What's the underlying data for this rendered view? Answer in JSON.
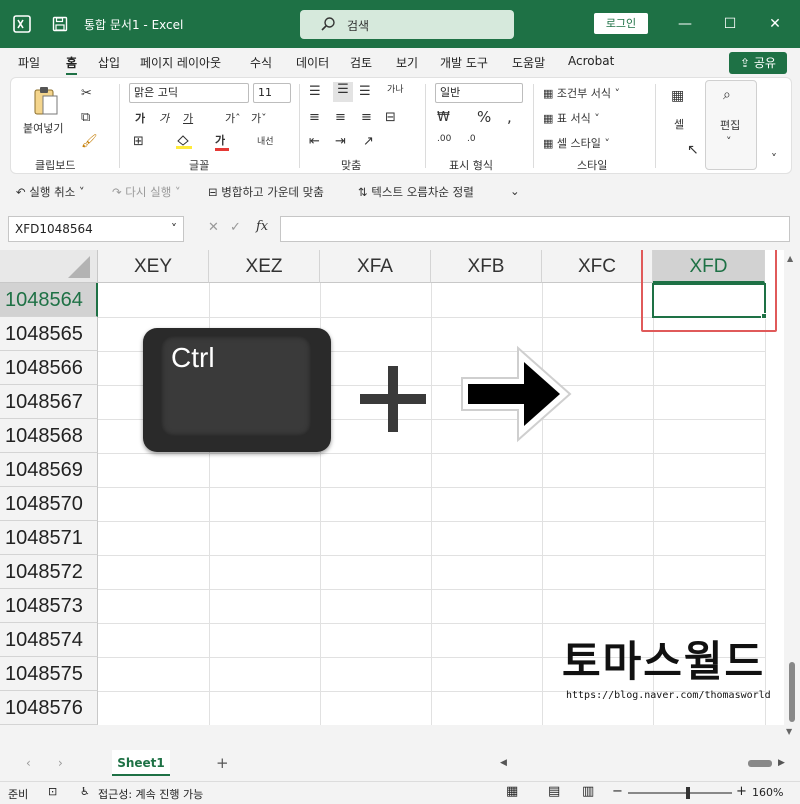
{
  "app": {
    "doc_title": "통합 문서1  -  Excel",
    "search_placeholder": "검색",
    "login_label": "로그인",
    "share_label": "공유"
  },
  "menu": {
    "tabs": [
      "파일",
      "홈",
      "삽입",
      "페이지 레이아웃",
      "수식",
      "데이터",
      "검토",
      "보기",
      "개발 도구",
      "도움말",
      "Acrobat"
    ],
    "active": "홈"
  },
  "ribbon": {
    "paste_label": "붙여넣기",
    "clipboard_label": "클립보드",
    "font_name": "맑은 고딕",
    "font_size": "11",
    "font_group_label": "글꼴",
    "align_group_label": "맞춤",
    "number_format": "일반",
    "number_group_label": "표시 형식",
    "cond_format_label": "조건부 서식",
    "table_format_label": "표 서식",
    "cell_style_label": "셀 스타일",
    "style_group_label": "스타일",
    "cells_label": "셀",
    "edit_label": "편집"
  },
  "quickbar": {
    "undo": "실행 취소",
    "redo": "다시 실행",
    "merge": "병합하고 가운데 맞춤",
    "sort": "텍스트 오름차순 정렬"
  },
  "formula_bar": {
    "name_box": "XFD1048564",
    "fx": "fx"
  },
  "grid": {
    "columns": [
      "XEY",
      "XEZ",
      "XFA",
      "XFB",
      "XFC",
      "XFD"
    ],
    "selected_column": "XFD",
    "rows": [
      "1048564",
      "1048565",
      "1048566",
      "1048567",
      "1048568",
      "1048569",
      "1048570",
      "1048571",
      "1048572",
      "1048573",
      "1048574",
      "1048575",
      "1048576"
    ],
    "selected_row": "1048564"
  },
  "overlay": {
    "key_label": "Ctrl",
    "watermark": "토마스월드",
    "watermark_url": "https://blog.naver.com/thomasworld"
  },
  "sheets": {
    "active_tab": "Sheet1"
  },
  "status": {
    "ready": "준비",
    "accessibility": "접근성: 계속 진행 가능",
    "zoom": "160%"
  },
  "colors": {
    "excel_green": "#1e7145",
    "highlight_red": "#e05a5a"
  }
}
